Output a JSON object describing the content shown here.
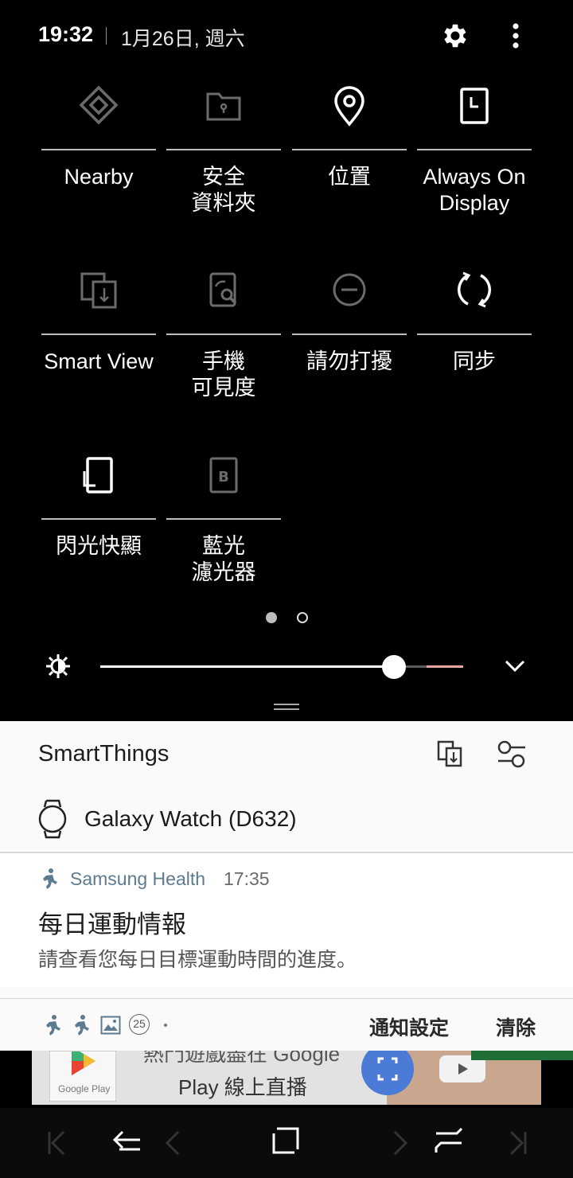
{
  "status": {
    "time": "19:32",
    "date": "1月26日, 週六",
    "icons": [
      "settings-gear-icon",
      "more-options-icon"
    ]
  },
  "tiles": [
    {
      "label": "Nearby",
      "icon": "nearby-share-icon",
      "state": "off"
    },
    {
      "label": "安全\n資料夾",
      "icon": "secure-folder-icon",
      "state": "off"
    },
    {
      "label": "位置",
      "icon": "location-pin-icon",
      "state": "on"
    },
    {
      "label": "Always On\nDisplay",
      "icon": "always-on-display-icon",
      "state": "on"
    },
    {
      "label": "Smart View",
      "icon": "smart-view-icon",
      "state": "off"
    },
    {
      "label": "手機\n可見度",
      "icon": "phone-visibility-icon",
      "state": "off"
    },
    {
      "label": "請勿打擾",
      "icon": "do-not-disturb-icon",
      "state": "off"
    },
    {
      "label": "同步",
      "icon": "sync-icon",
      "state": "on"
    },
    {
      "label": "閃光快顯",
      "icon": "flash-screen-icon",
      "state": "on"
    },
    {
      "label": "藍光\n濾光器",
      "icon": "blue-light-filter-icon",
      "state": "off"
    }
  ],
  "pager": {
    "pages": 2,
    "current": 1
  },
  "brightness": {
    "level": 0.81,
    "warning_start": 0.9,
    "icon": "brightness-sun-icon"
  },
  "smartthings": {
    "title": "SmartThings",
    "icons": [
      "smart-view-share-icon",
      "filter-settings-icon"
    ],
    "device": "Galaxy Watch (D632)"
  },
  "notification": {
    "app": "Samsung Health",
    "time": "17:35",
    "title": "每日運動情報",
    "body": "請查看您每日目標運動時間的進度。"
  },
  "footer": {
    "count": "25",
    "settings_label": "通知設定",
    "clear_label": "清除"
  },
  "ad": {
    "line1": "熱門遊戲盡在 Google",
    "line2": "Play 線上直播",
    "store_label": "Google Play"
  },
  "colors": {
    "panel_bg": "#fafafa",
    "app_name": "#5c7b8f",
    "brightness_warn": "#e8a6a0"
  }
}
